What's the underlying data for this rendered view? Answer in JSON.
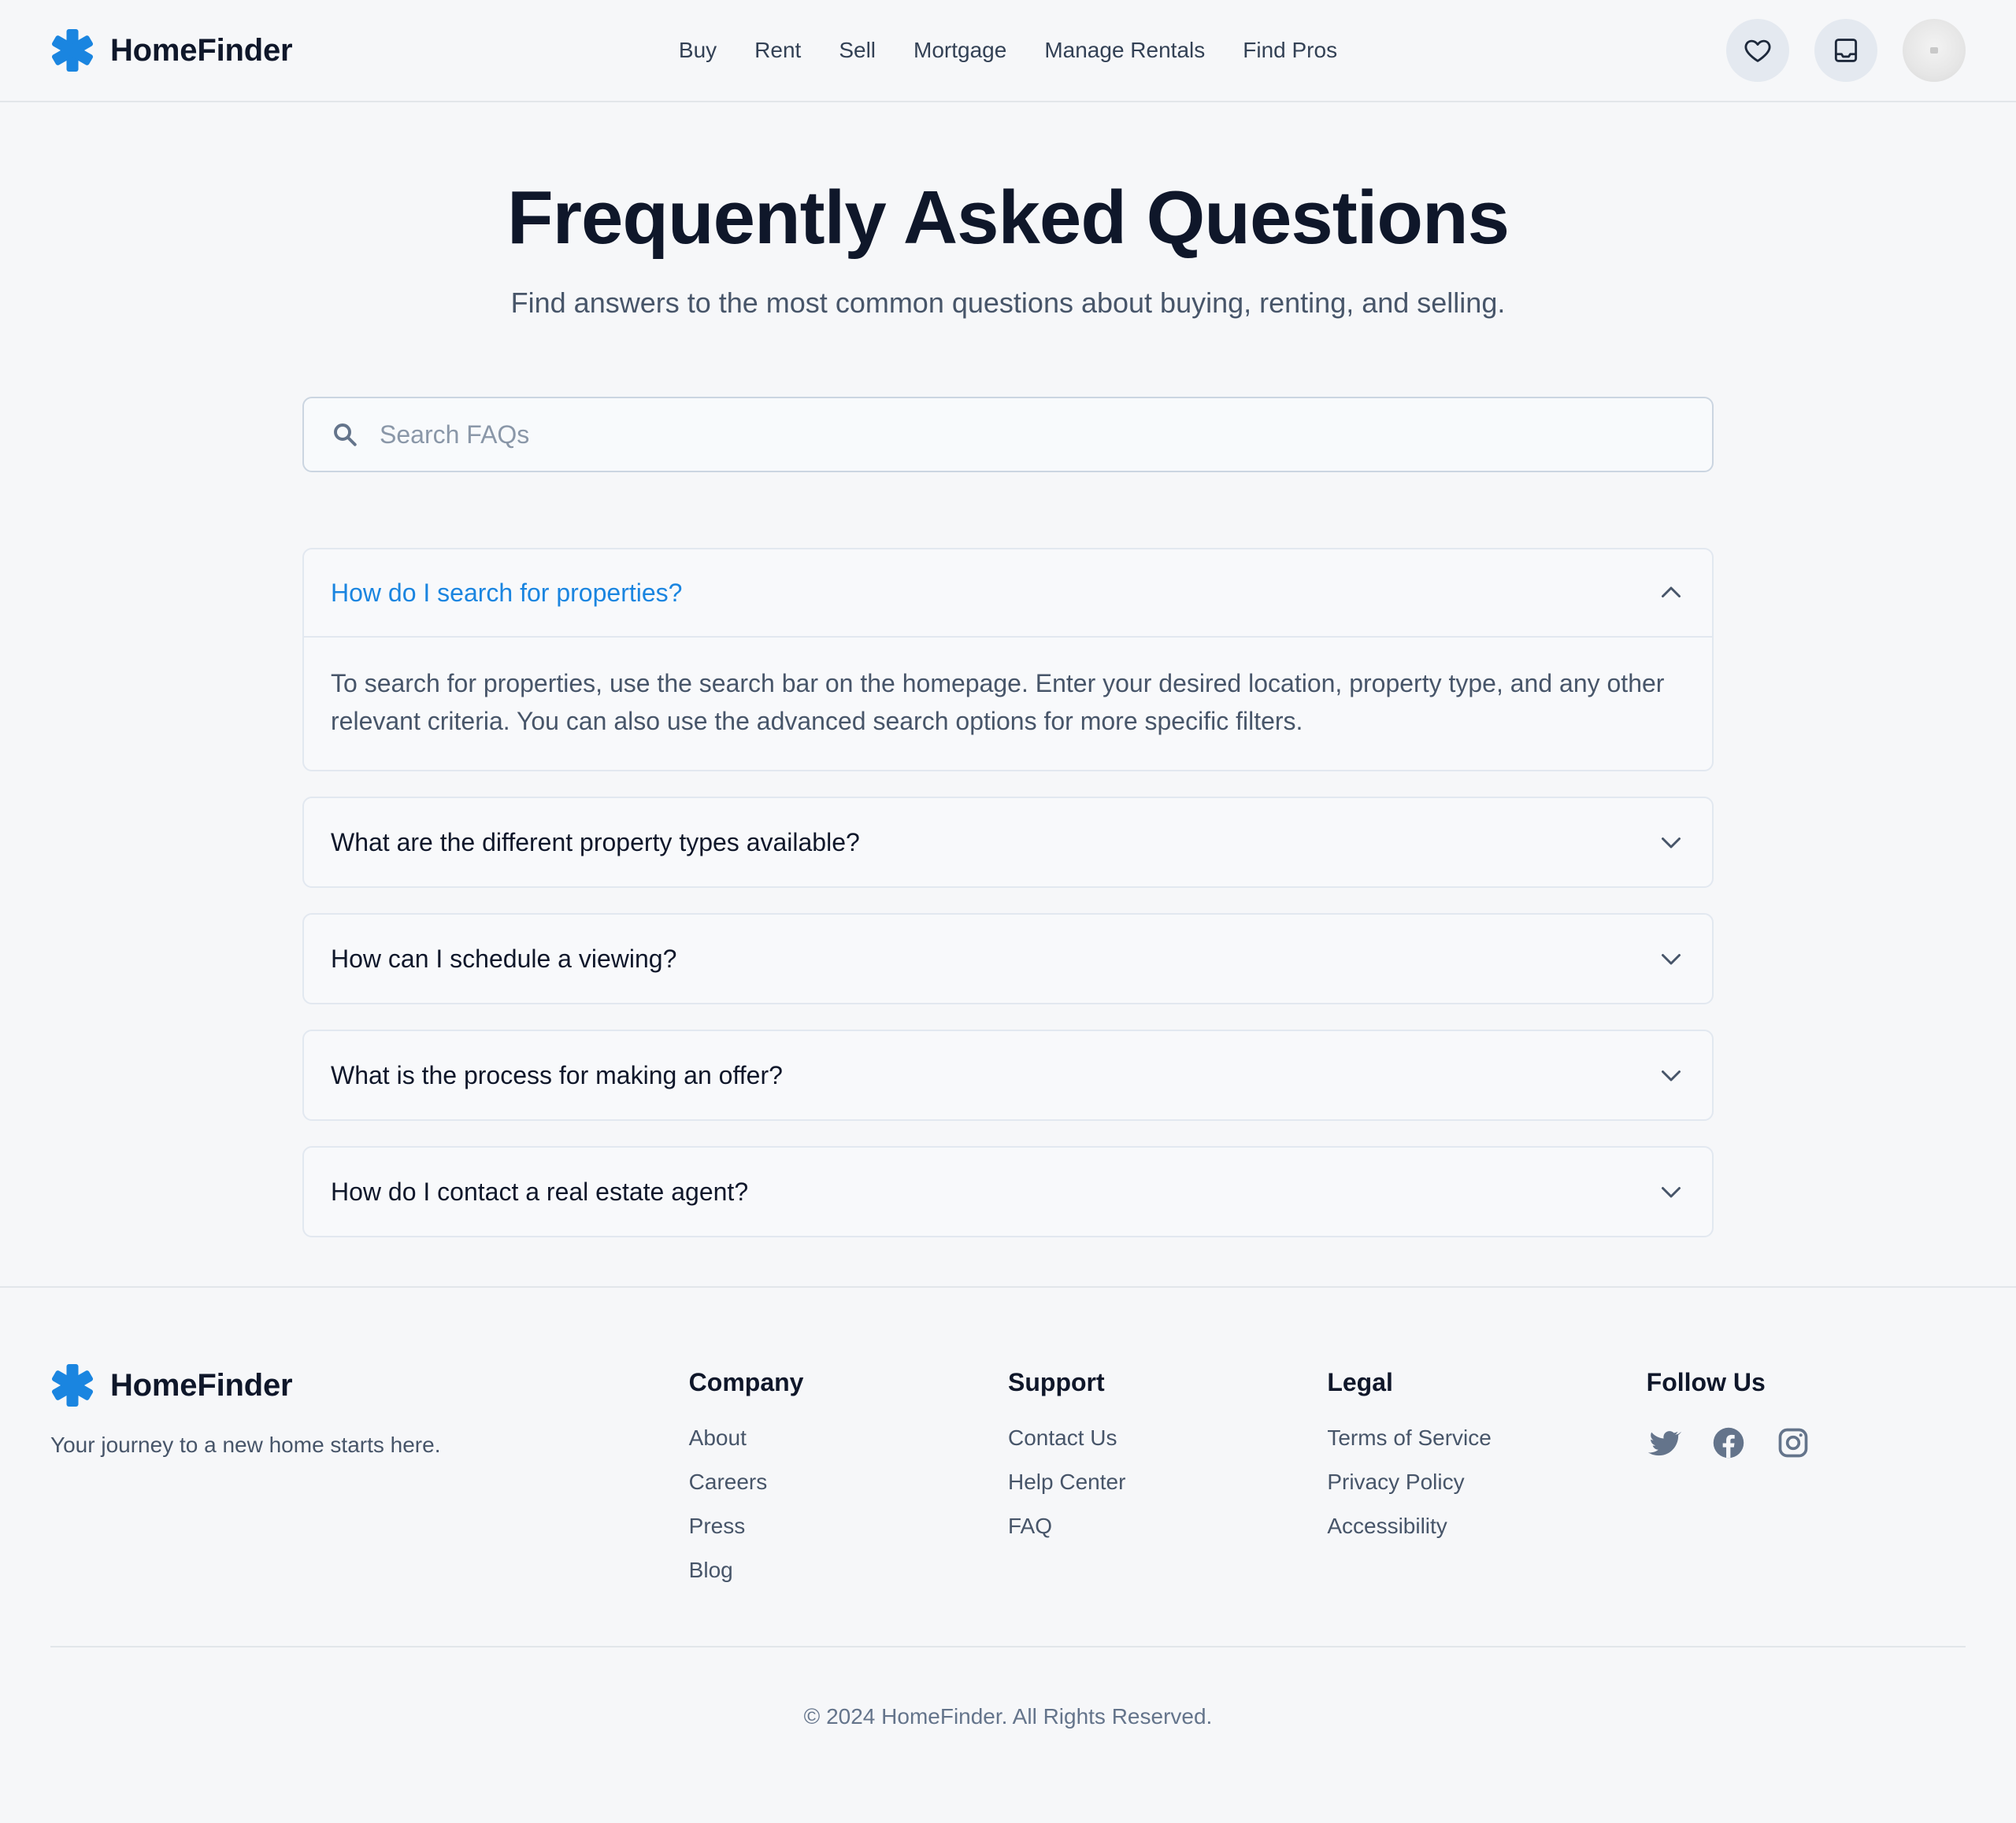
{
  "brand": {
    "name": "HomeFinder",
    "accent_color": "#1a85e0",
    "icon": "asterisk-logo-icon"
  },
  "nav": {
    "links": [
      "Buy",
      "Rent",
      "Sell",
      "Mortgage",
      "Manage Rentals",
      "Find Pros"
    ]
  },
  "header_actions": {
    "favorites_icon": "heart-icon",
    "inbox_icon": "inbox-icon",
    "profile": "avatar"
  },
  "hero": {
    "title": "Frequently Asked Questions",
    "subtitle": "Find answers to the most common questions about buying, renting, and selling."
  },
  "search": {
    "placeholder": "Search FAQs",
    "value": "",
    "icon": "search-icon"
  },
  "faqs": [
    {
      "question": "How do I search for properties?",
      "answer": "To search for properties, use the search bar on the homepage. Enter your desired location, property type, and any other relevant criteria. You can also use the advanced search options for more specific filters.",
      "expanded": true
    },
    {
      "question": "What are the different property types available?",
      "expanded": false
    },
    {
      "question": "How can I schedule a viewing?",
      "expanded": false
    },
    {
      "question": "What is the process for making an offer?",
      "expanded": false
    },
    {
      "question": "How do I contact a real estate agent?",
      "expanded": false
    }
  ],
  "footer": {
    "brand_name": "HomeFinder",
    "tagline": "Your journey to a new home starts here.",
    "columns": [
      {
        "title": "Company",
        "links": [
          "About",
          "Careers",
          "Press",
          "Blog"
        ]
      },
      {
        "title": "Support",
        "links": [
          "Contact Us",
          "Help Center",
          "FAQ"
        ]
      },
      {
        "title": "Legal",
        "links": [
          "Terms of Service",
          "Privacy Policy",
          "Accessibility"
        ]
      }
    ],
    "social": {
      "title": "Follow Us",
      "icons": [
        "twitter-icon",
        "facebook-icon",
        "instagram-icon"
      ]
    },
    "copyright": "© 2024 HomeFinder. All Rights Reserved."
  }
}
